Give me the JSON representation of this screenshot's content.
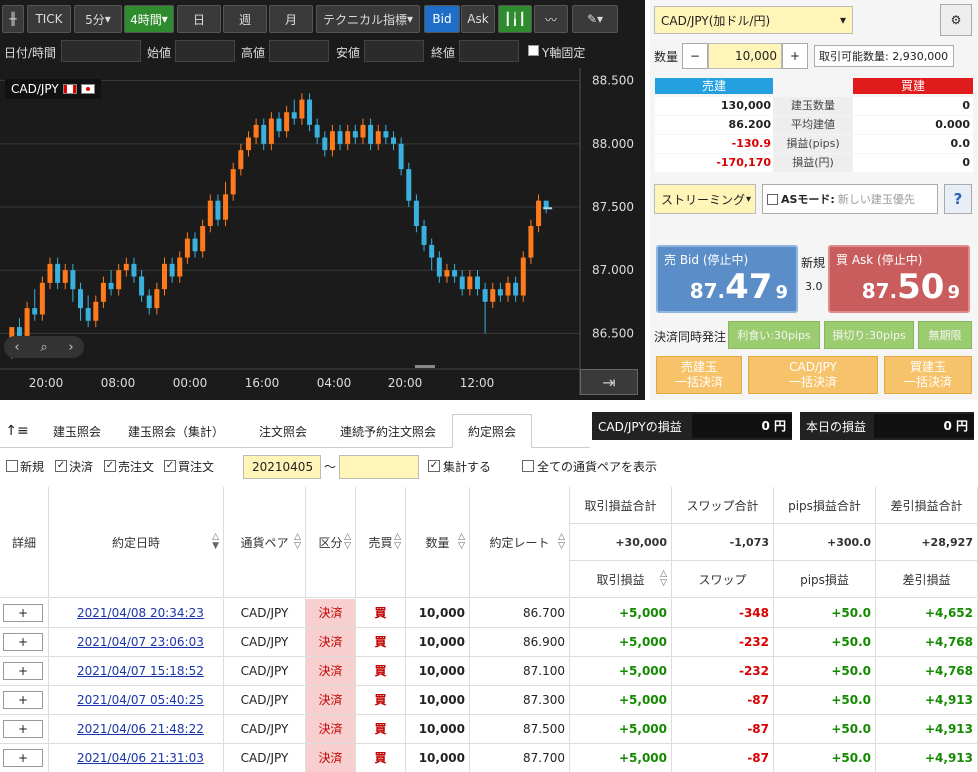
{
  "toolbar": {
    "tick": "TICK",
    "period": "5分",
    "interval": "4時間",
    "day": "日",
    "week": "週",
    "month": "月",
    "technical": "テクニカル指標",
    "bid": "Bid",
    "ask": "Ask"
  },
  "ohlc": {
    "datetime_label": "日付/時間",
    "open_label": "始値",
    "high_label": "高値",
    "low_label": "安値",
    "close_label": "終値",
    "y_fixed_label": "Y軸固定"
  },
  "chart": {
    "symbol": "CAD/JPY",
    "y_ticks": [
      "86.500",
      "87.000",
      "87.500",
      "88.000",
      "88.500"
    ],
    "x_ticks": [
      "20:00",
      "08:00",
      "00:00",
      "16:00",
      "04:00",
      "20:00",
      "12:00"
    ],
    "colors": {
      "up": "#ff7a1c",
      "down": "#3ab0dc",
      "bg": "#1b1b1b"
    }
  },
  "chart_data": {
    "type": "candlestick",
    "ylim": [
      86.25,
      88.6
    ],
    "candles": [
      [
        86.45,
        86.55,
        86.37,
        86.3
      ],
      [
        86.55,
        86.48,
        86.62,
        86.42
      ],
      [
        86.48,
        86.7,
        86.75,
        86.45
      ],
      [
        86.7,
        86.65,
        86.85,
        86.6
      ],
      [
        86.65,
        86.9,
        86.95,
        86.6
      ],
      [
        86.9,
        87.05,
        87.1,
        86.85
      ],
      [
        87.05,
        86.9,
        87.1,
        86.85
      ],
      [
        86.9,
        87.0,
        87.05,
        86.85
      ],
      [
        87.0,
        86.85,
        87.05,
        86.75
      ],
      [
        86.85,
        86.7,
        86.9,
        86.6
      ],
      [
        86.7,
        86.6,
        86.8,
        86.55
      ],
      [
        86.6,
        86.75,
        86.8,
        86.55
      ],
      [
        86.75,
        86.9,
        86.95,
        86.7
      ],
      [
        86.9,
        86.85,
        87.0,
        86.8
      ],
      [
        86.85,
        87.0,
        87.05,
        86.8
      ],
      [
        87.0,
        87.05,
        87.1,
        86.95
      ],
      [
        87.05,
        86.95,
        87.1,
        86.9
      ],
      [
        86.95,
        86.8,
        87.0,
        86.75
      ],
      [
        86.8,
        86.7,
        86.85,
        86.65
      ],
      [
        86.7,
        86.85,
        86.9,
        86.65
      ],
      [
        86.85,
        87.05,
        87.1,
        86.8
      ],
      [
        87.05,
        86.95,
        87.1,
        86.9
      ],
      [
        86.95,
        87.1,
        87.15,
        86.9
      ],
      [
        87.1,
        87.25,
        87.3,
        87.05
      ],
      [
        87.25,
        87.15,
        87.3,
        87.1
      ],
      [
        87.15,
        87.35,
        87.4,
        87.1
      ],
      [
        87.35,
        87.55,
        87.6,
        87.3
      ],
      [
        87.55,
        87.4,
        87.6,
        87.35
      ],
      [
        87.4,
        87.6,
        87.7,
        87.35
      ],
      [
        87.6,
        87.8,
        87.85,
        87.55
      ],
      [
        87.8,
        87.95,
        88.0,
        87.75
      ],
      [
        87.95,
        88.05,
        88.1,
        87.9
      ],
      [
        88.05,
        88.15,
        88.2,
        88.0
      ],
      [
        88.15,
        88.0,
        88.2,
        87.95
      ],
      [
        88.0,
        88.2,
        88.25,
        87.95
      ],
      [
        88.2,
        88.1,
        88.25,
        88.05
      ],
      [
        88.1,
        88.25,
        88.3,
        88.05
      ],
      [
        88.25,
        88.2,
        88.35,
        88.15
      ],
      [
        88.2,
        88.35,
        88.4,
        88.15
      ],
      [
        88.35,
        88.15,
        88.4,
        88.1
      ],
      [
        88.15,
        88.05,
        88.2,
        88.0
      ],
      [
        88.05,
        87.95,
        88.1,
        87.9
      ],
      [
        87.95,
        88.1,
        88.15,
        87.9
      ],
      [
        88.1,
        88.0,
        88.15,
        87.95
      ],
      [
        88.0,
        88.1,
        88.15,
        87.95
      ],
      [
        88.1,
        88.05,
        88.15,
        88.0
      ],
      [
        88.05,
        88.15,
        88.2,
        88.0
      ],
      [
        88.15,
        88.0,
        88.2,
        87.95
      ],
      [
        88.0,
        88.1,
        88.15,
        87.95
      ],
      [
        88.1,
        88.05,
        88.15,
        88.0
      ],
      [
        88.05,
        88.0,
        88.1,
        87.95
      ],
      [
        88.0,
        87.8,
        88.05,
        87.75
      ],
      [
        87.8,
        87.55,
        87.85,
        87.5
      ],
      [
        87.55,
        87.35,
        87.6,
        87.3
      ],
      [
        87.35,
        87.2,
        87.4,
        87.15
      ],
      [
        87.2,
        87.1,
        87.25,
        87.0
      ],
      [
        87.1,
        86.95,
        87.15,
        86.9
      ],
      [
        86.95,
        87.0,
        87.05,
        86.9
      ],
      [
        87.0,
        86.95,
        87.05,
        86.9
      ],
      [
        86.95,
        86.85,
        87.0,
        86.8
      ],
      [
        86.85,
        86.95,
        87.0,
        86.8
      ],
      [
        86.95,
        86.85,
        87.0,
        86.8
      ],
      [
        86.85,
        86.75,
        86.9,
        86.5
      ],
      [
        86.75,
        86.85,
        86.9,
        86.7
      ],
      [
        86.85,
        86.8,
        86.9,
        86.75
      ],
      [
        86.8,
        86.9,
        86.95,
        86.75
      ],
      [
        86.9,
        86.8,
        86.95,
        86.75
      ],
      [
        86.8,
        87.1,
        87.15,
        86.75
      ],
      [
        87.1,
        87.35,
        87.4,
        87.05
      ],
      [
        87.35,
        87.55,
        87.6,
        87.3
      ],
      [
        87.55,
        87.49,
        87.55,
        87.45
      ]
    ]
  },
  "order": {
    "pair": "CAD/JPY(加ドル/円)",
    "qty_label": "数量",
    "minus": "−",
    "qty": "10,000",
    "plus": "+",
    "avail": "取引可能数量: 2,930,000",
    "sell_head": "売建",
    "buy_head": "買建",
    "rows": [
      {
        "l": "130,000",
        "m": "建玉数量",
        "r": "0",
        "lc": "",
        "rc": ""
      },
      {
        "l": "86.200",
        "m": "平均建値",
        "r": "0.000",
        "lc": "",
        "rc": ""
      },
      {
        "l": "-130.9",
        "m": "損益(pips)",
        "r": "0.0",
        "lc": "red",
        "rc": ""
      },
      {
        "l": "-170,170",
        "m": "損益(円)",
        "r": "0",
        "lc": "red",
        "rc": ""
      }
    ],
    "mode": "ストリーミング",
    "as_mode": "ASモード:",
    "as_value": "新しい建玉優先",
    "help": "?",
    "sell_label": "売 Bid (停止中)",
    "sell_price_a": "87.",
    "sell_price_b": "47",
    "sell_price_c": "9",
    "buy_label": "買 Ask (停止中)",
    "buy_price_a": "87.",
    "buy_price_b": "50",
    "buy_price_c": "9",
    "new_label": "新規",
    "spread": "3.0",
    "settle_label": "決済同時発注",
    "take_profit": "利食い:30pips",
    "stop_loss": "損切り:30pips",
    "no_limit": "無期限",
    "close_sell_1": "売建玉",
    "close_sell_2": "一括決済",
    "close_pair_1": "CAD/JPY",
    "close_pair_2": "一括決済",
    "close_buy_1": "買建玉",
    "close_buy_2": "一括決済"
  },
  "tabs": [
    "建玉照会",
    "建玉照会（集計）",
    "注文照会",
    "連続予約注文照会",
    "約定照会"
  ],
  "pl": {
    "pair_label": "CAD/JPYの損益",
    "pair_value": "0 円",
    "today_label": "本日の損益",
    "today_value": "0 円"
  },
  "filter": {
    "new": "新規",
    "settle": "決済",
    "sell": "売注文",
    "buy": "買注文",
    "from": "20210405",
    "tilde": "〜",
    "to": "",
    "aggregate": "集計する",
    "all_pairs": "全ての通貨ペアを表示"
  },
  "grid": {
    "h_detail": "詳細",
    "h_date": "約定日時",
    "h_pair": "通貨ペア",
    "h_kind": "区分",
    "h_side": "売買",
    "h_qty": "数量",
    "h_rate": "約定レート",
    "h_tpl_total": "取引損益合計",
    "h_swap_total": "スワップ合計",
    "h_pips_total": "pips損益合計",
    "h_net_total": "差引損益合計",
    "t_tpl": "+30,000",
    "t_swap": "-1,073",
    "t_pips": "+300.0",
    "t_net": "+28,927",
    "h_tpl": "取引損益",
    "h_swap": "スワップ",
    "h_pips": "pips損益",
    "h_net": "差引損益",
    "plus_label": "+",
    "rows": [
      {
        "date": "2021/04/08 20:34:23",
        "pair": "CAD/JPY",
        "kind": "決済",
        "side": "買",
        "qty": "10,000",
        "rate": "86.700",
        "tpl": "+5,000",
        "swap": "-348",
        "pips": "+50.0",
        "net": "+4,652"
      },
      {
        "date": "2021/04/07 23:06:03",
        "pair": "CAD/JPY",
        "kind": "決済",
        "side": "買",
        "qty": "10,000",
        "rate": "86.900",
        "tpl": "+5,000",
        "swap": "-232",
        "pips": "+50.0",
        "net": "+4,768"
      },
      {
        "date": "2021/04/07 15:18:52",
        "pair": "CAD/JPY",
        "kind": "決済",
        "side": "買",
        "qty": "10,000",
        "rate": "87.100",
        "tpl": "+5,000",
        "swap": "-232",
        "pips": "+50.0",
        "net": "+4,768"
      },
      {
        "date": "2021/04/07 05:40:25",
        "pair": "CAD/JPY",
        "kind": "決済",
        "side": "買",
        "qty": "10,000",
        "rate": "87.300",
        "tpl": "+5,000",
        "swap": "-87",
        "pips": "+50.0",
        "net": "+4,913"
      },
      {
        "date": "2021/04/06 21:48:22",
        "pair": "CAD/JPY",
        "kind": "決済",
        "side": "買",
        "qty": "10,000",
        "rate": "87.500",
        "tpl": "+5,000",
        "swap": "-87",
        "pips": "+50.0",
        "net": "+4,913"
      },
      {
        "date": "2021/04/06 21:31:03",
        "pair": "CAD/JPY",
        "kind": "決済",
        "side": "買",
        "qty": "10,000",
        "rate": "87.700",
        "tpl": "+5,000",
        "swap": "-87",
        "pips": "+50.0",
        "net": "+4,913"
      }
    ]
  }
}
